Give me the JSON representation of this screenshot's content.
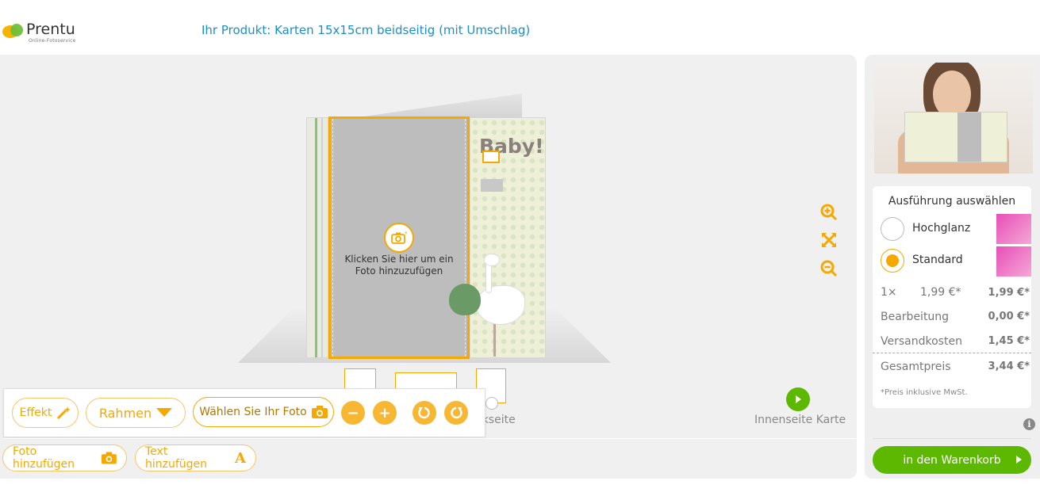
{
  "header": {
    "logo_name": "Prentu",
    "logo_sub": "Online-Fotoservice",
    "product_title": "Ihr Produkt: Karten 15x15cm beidseitig (mit Umschlag)"
  },
  "canvas": {
    "photo_hint": "Klicken Sie hier um ein Foto hinzuzufügen",
    "card_text": "Baby!"
  },
  "zoom": {
    "zoom_in": "zoom-in-icon",
    "fit": "fit-screen-icon",
    "zoom_out": "zoom-out-icon"
  },
  "pages": {
    "back_label": "ckseite",
    "inner_label": "Innenseite Karte"
  },
  "toolbar": {
    "effekt": "Effekt",
    "rahmen": "Rahmen",
    "choose_photo": "Wählen Sie Ihr Foto",
    "minus": "−",
    "plus": "+"
  },
  "bottom": {
    "add_photo": "Foto hinzufügen",
    "add_text": "Text hinzufügen",
    "text_icon_letter": "A"
  },
  "sidebar": {
    "options_title": "Ausführung auswählen",
    "options": [
      {
        "label": "Hochglanz",
        "selected": false
      },
      {
        "label": "Standard",
        "selected": true
      }
    ],
    "prices": {
      "qty": "1×",
      "unit_price": "1,99 €*",
      "line_total": "1,99 €*",
      "bearbeitung_label": "Bearbeitung",
      "bearbeitung_value": "0,00 €*",
      "versand_label": "Versandkosten",
      "versand_value": "1,45 €*",
      "gesamt_label": "Gesamtpreis",
      "gesamt_value": "3,44 €*"
    },
    "note": "*Preis inklusive MwSt.",
    "info": "i",
    "cart_button": "in den Warenkorb"
  },
  "colors": {
    "accent": "#f5a800",
    "title_blue": "#1b8fc6",
    "cart_green": "#5cb800"
  }
}
